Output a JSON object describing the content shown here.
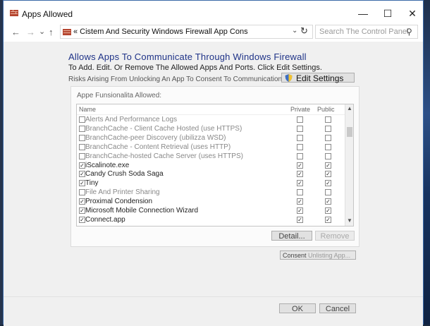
{
  "window": {
    "title": "Apps Allowed",
    "minimize": "—",
    "maximize": "☐",
    "close": "✕"
  },
  "address": {
    "back": "←",
    "forward": "→",
    "history": "⌄",
    "up": "↑",
    "path": "« Cistem And Security Windows Firewall App Cons",
    "dropdown": "⌄",
    "refresh": "↻",
    "search_placeholder": "Search The Control Panel",
    "search_icon": "⚲"
  },
  "content": {
    "heading": "Allows Apps To Communicate Through Windows Firewall",
    "subheading": "To Add. Edit. Or Remove The Allowed Apps And Ports. Click Edit Settings.",
    "risk_text": "Risks Arising From Unlocking An App To Consent To Communication",
    "edit_settings_label": "Edit Settings"
  },
  "list": {
    "group_label": "Appe Funsionalita Allowed:",
    "col_name": "Name",
    "col_private": "Private",
    "col_public": "Public",
    "rows": [
      {
        "name": "Alerts And Performance Logs",
        "enabled": false,
        "private": false,
        "public": false
      },
      {
        "name": "BranchCache - Client Cache Hosted (use HTTPS)",
        "enabled": false,
        "private": false,
        "public": false
      },
      {
        "name": "BranchCache-peer Discovery (ubilizza WSD)",
        "enabled": false,
        "private": false,
        "public": false
      },
      {
        "name": "BranchCache - Content Retrieval (uses HTTP)",
        "enabled": false,
        "private": false,
        "public": false
      },
      {
        "name": "BranchCache-hosted Cache Server (uses HTTPS)",
        "enabled": false,
        "private": false,
        "public": false
      },
      {
        "name": "iScalinote.exe",
        "enabled": true,
        "private": true,
        "public": true
      },
      {
        "name": "Candy Crush Soda Saga",
        "enabled": true,
        "private": true,
        "public": true
      },
      {
        "name": "Tiny",
        "enabled": true,
        "private": true,
        "public": true
      },
      {
        "name": "File And Printer Sharing",
        "enabled": false,
        "private": false,
        "public": false
      },
      {
        "name": "Proximal Condension",
        "enabled": true,
        "private": true,
        "public": true
      },
      {
        "name": "Microsoft Mobile Connection Wizard",
        "enabled": true,
        "private": true,
        "public": true
      },
      {
        "name": "Connect.app",
        "enabled": true,
        "private": true,
        "public": true
      }
    ],
    "details_label": "Detail...",
    "remove_label": "Remove"
  },
  "consent": {
    "label": "Consent",
    "suffix": "Unlisting App..."
  },
  "footer": {
    "ok_label": "OK",
    "cancel_label": "Cancel"
  },
  "colors": {
    "heading": "#1e3287",
    "window_border": "#3b6aa8"
  }
}
